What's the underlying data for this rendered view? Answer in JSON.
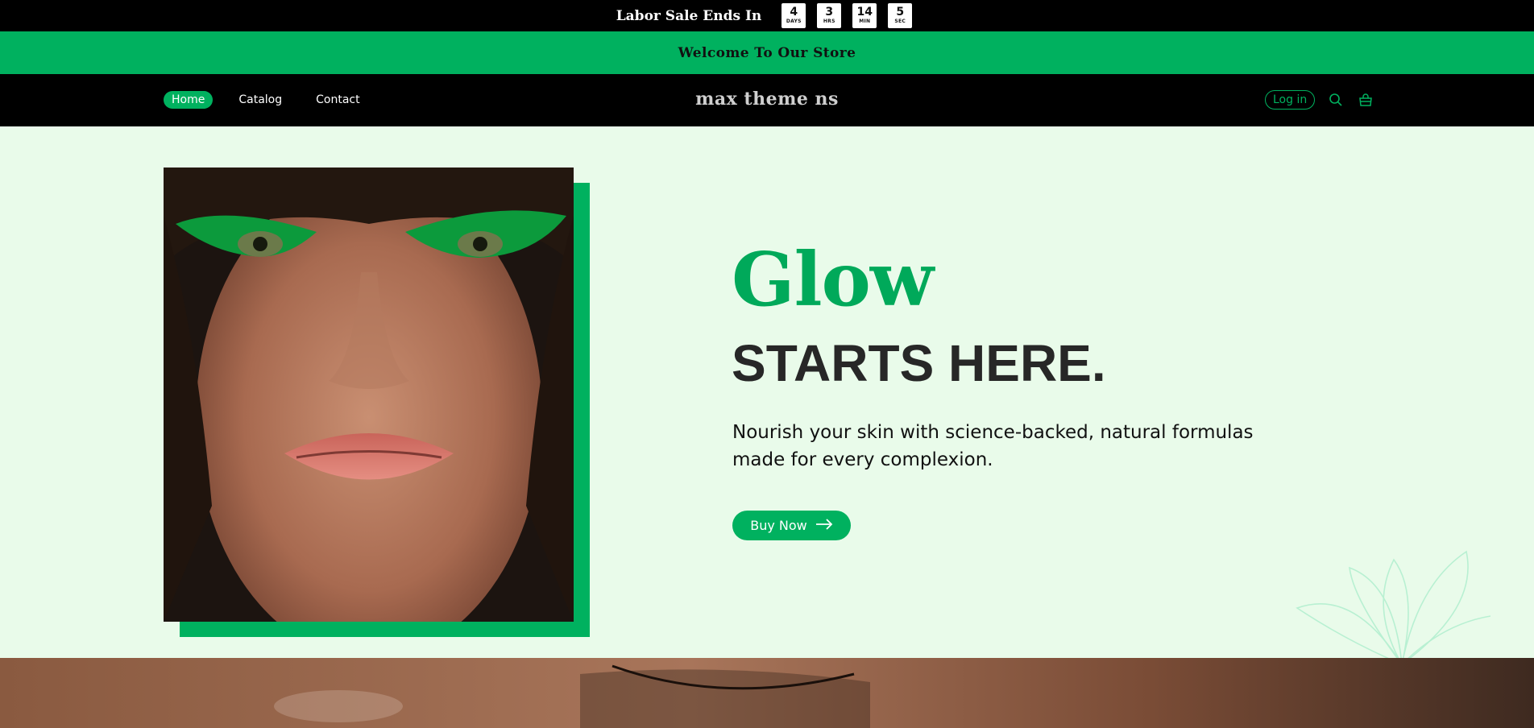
{
  "countdown": {
    "title": "Labor Sale Ends In",
    "units": [
      {
        "value": "4",
        "label": "DAYS"
      },
      {
        "value": "3",
        "label": "HRS"
      },
      {
        "value": "14",
        "label": "MIN"
      },
      {
        "value": "5",
        "label": "SEC"
      }
    ]
  },
  "announcement": {
    "text": "Welcome To Our Store"
  },
  "header": {
    "nav": [
      {
        "label": "Home",
        "active": true
      },
      {
        "label": "Catalog",
        "active": false
      },
      {
        "label": "Contact",
        "active": false
      }
    ],
    "logo": "max theme ns",
    "login_label": "Log in",
    "icons": [
      "search-icon",
      "cart-icon"
    ]
  },
  "hero": {
    "title": "Glow",
    "subtitle": "STARTS HERE.",
    "text": "Nourish your skin with science-backed, natural formulas made for every complexion.",
    "button_label": "Buy Now",
    "button_icon": "arrow-right-icon"
  },
  "colors": {
    "accent": "#00b15f",
    "background": "#e9fbea",
    "dark": "#000000"
  }
}
